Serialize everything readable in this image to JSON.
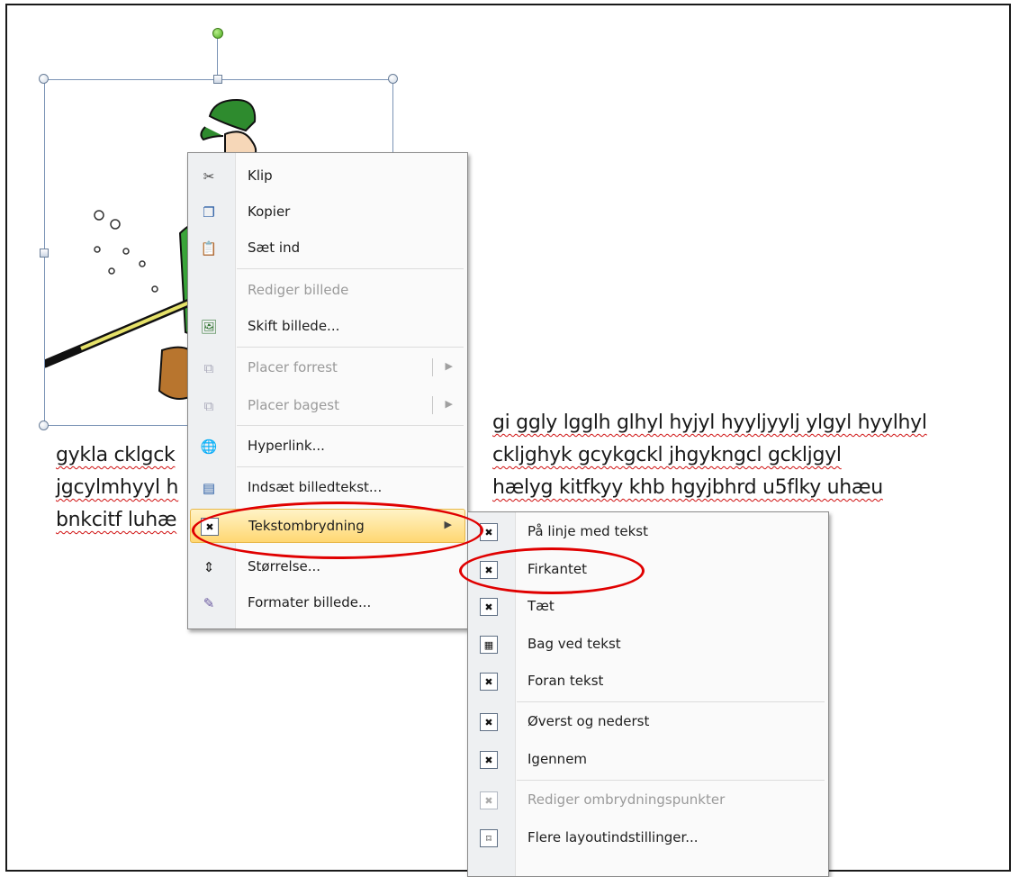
{
  "document": {
    "lines": [
      "gi ggly lgglh glhyl hyjyl hyyljyylj ylgyl hyylhyl",
      "gykla cklgck",
      "ckljghyk gcykgckl jhgykngcl gckljgyl",
      "jgcylmhyyl h",
      "hælyg kitfkyy khb hgyjbhrd u5flky uhæu",
      "bnkcitf luhæ"
    ]
  },
  "context_menu": {
    "items": [
      {
        "label": "Klip",
        "icon": "scissors-icon",
        "glyph": "✂",
        "disabled": false
      },
      {
        "label": "Kopier",
        "icon": "copy-icon",
        "glyph": "❐",
        "disabled": false
      },
      {
        "label": "Sæt ind",
        "icon": "paste-icon",
        "glyph": "📋",
        "disabled": false
      },
      {
        "label": "Rediger billede",
        "icon": "edit-picture-icon",
        "glyph": "",
        "disabled": true
      },
      {
        "label": "Skift billede...",
        "icon": "change-picture-icon",
        "glyph": "🖼",
        "disabled": false
      },
      {
        "label": "Placer forrest",
        "icon": "bring-to-front-icon",
        "glyph": "⧉",
        "disabled": true,
        "submenu": true
      },
      {
        "label": "Placer bagest",
        "icon": "send-to-back-icon",
        "glyph": "⧉",
        "disabled": true,
        "submenu": true
      },
      {
        "label": "Hyperlink...",
        "icon": "hyperlink-icon",
        "glyph": "🌐",
        "disabled": false
      },
      {
        "label": "Indsæt billedtekst...",
        "icon": "insert-caption-icon",
        "glyph": "▤",
        "disabled": false
      },
      {
        "label": "Tekstombrydning",
        "icon": "text-wrap-icon",
        "glyph": "✖",
        "disabled": false,
        "submenu": true,
        "highlighted": true
      },
      {
        "label": "Størrelse...",
        "icon": "size-icon",
        "glyph": "⇕",
        "disabled": false
      },
      {
        "label": "Formater billede...",
        "icon": "format-picture-icon",
        "glyph": "✎",
        "disabled": false
      }
    ]
  },
  "submenu": {
    "items": [
      {
        "label": "På linje med tekst",
        "icon": "inline-with-text-icon",
        "disabled": false
      },
      {
        "label": "Firkantet",
        "icon": "square-wrap-icon",
        "disabled": false
      },
      {
        "label": "Tæt",
        "icon": "tight-wrap-icon",
        "disabled": false
      },
      {
        "label": "Bag ved tekst",
        "icon": "behind-text-icon",
        "disabled": false
      },
      {
        "label": "Foran tekst",
        "icon": "in-front-of-text-icon",
        "disabled": false
      },
      {
        "label": "Øverst og nederst",
        "icon": "top-and-bottom-icon",
        "disabled": false
      },
      {
        "label": "Igennem",
        "icon": "through-wrap-icon",
        "disabled": false
      },
      {
        "label": "Rediger ombrydningspunkter",
        "icon": "edit-wrap-points-icon",
        "disabled": true
      },
      {
        "label": "Flere layoutindstillinger...",
        "icon": "more-layout-options-icon",
        "disabled": false
      }
    ]
  },
  "colors": {
    "annotation": "#e00000",
    "highlight": "#ffd772"
  }
}
